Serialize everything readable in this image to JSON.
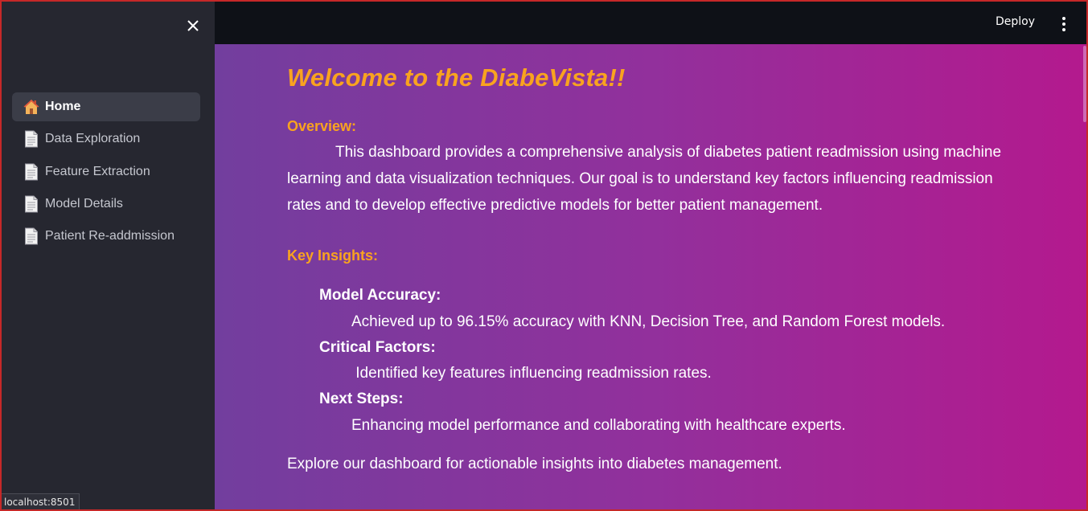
{
  "sidebar": {
    "items": [
      {
        "label": "Home",
        "icon": "house-icon",
        "active": true
      },
      {
        "label": "Data Exploration",
        "icon": "page-icon",
        "active": false
      },
      {
        "label": "Feature Extraction",
        "icon": "page-icon",
        "active": false
      },
      {
        "label": "Model Details",
        "icon": "page-icon",
        "active": false
      },
      {
        "label": "Patient Re-addmission",
        "icon": "page-icon",
        "active": false
      }
    ]
  },
  "header": {
    "deploy_label": "Deploy"
  },
  "main": {
    "title": "Welcome to the DiabeVista!!",
    "overview_heading": "Overview:",
    "overview_text": "This dashboard provides a comprehensive analysis of diabetes patient readmission using machine learning and data visualization techniques. Our goal is to understand key factors influencing readmission rates and to develop effective predictive models for better patient management.",
    "insights_heading": "Key Insights:",
    "insights": [
      {
        "label": "Model Accuracy:",
        "text": "Achieved up to 96.15% accuracy with KNN, Decision Tree, and Random Forest models."
      },
      {
        "label": "Critical Factors:",
        "text": " Identified key features influencing readmission rates."
      },
      {
        "label": "Next Steps:",
        "text": "Enhancing model performance and collaborating with healthcare experts."
      }
    ],
    "closing_text": "Explore our dashboard for actionable insights into diabetes management."
  },
  "status_bar": {
    "url": "localhost:8501"
  },
  "colors": {
    "accent": "#f9a31f",
    "sidebar_bg": "#262730",
    "header_bg": "#0e1117",
    "gradient_start": "#723e9e",
    "gradient_end": "#b4198e"
  }
}
